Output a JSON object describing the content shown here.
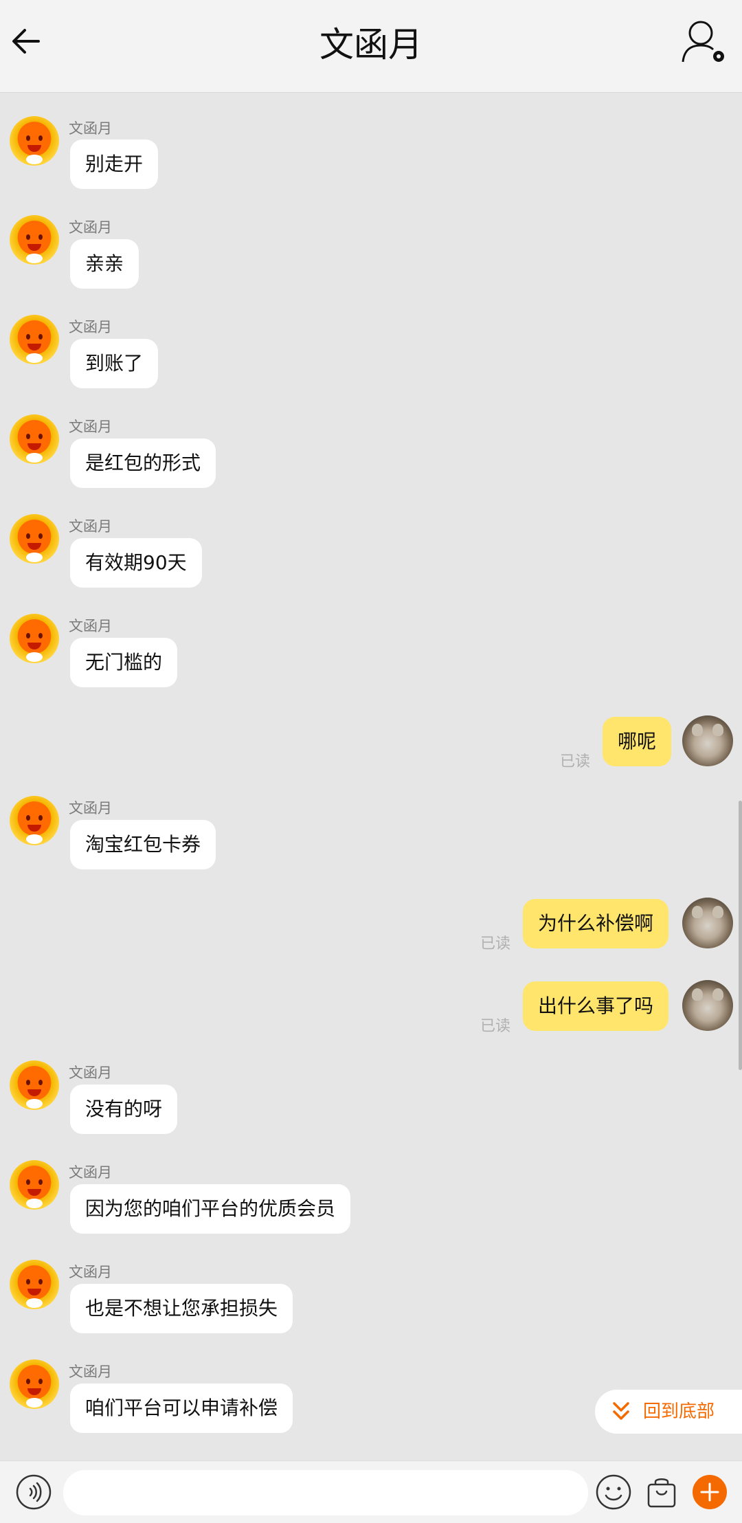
{
  "header": {
    "title": "文函月"
  },
  "messages": [
    {
      "side": "left",
      "sender": "文函月",
      "text": "别走开"
    },
    {
      "side": "left",
      "sender": "文函月",
      "text": "亲亲"
    },
    {
      "side": "left",
      "sender": "文函月",
      "text": "到账了"
    },
    {
      "side": "left",
      "sender": "文函月",
      "text": "是红包的形式"
    },
    {
      "side": "left",
      "sender": "文函月",
      "text": "有效期90天"
    },
    {
      "side": "left",
      "sender": "文函月",
      "text": "无门槛的"
    },
    {
      "side": "right",
      "text": "哪呢",
      "status": "已读"
    },
    {
      "side": "left",
      "sender": "文函月",
      "text": "淘宝红包卡券"
    },
    {
      "side": "right",
      "text": "为什么补偿啊",
      "status": "已读"
    },
    {
      "side": "right",
      "text": "出什么事了吗",
      "status": "已读"
    },
    {
      "side": "left",
      "sender": "文函月",
      "text": "没有的呀"
    },
    {
      "side": "left",
      "sender": "文函月",
      "text": "因为您的咱们平台的优质会员"
    },
    {
      "side": "left",
      "sender": "文函月",
      "text": "也是不想让您承担损失"
    },
    {
      "side": "left",
      "sender": "文函月",
      "text": "咱们平台可以申请补偿"
    }
  ],
  "back_to_bottom": {
    "label": "回到底部"
  },
  "input": {
    "placeholder": ""
  },
  "colors": {
    "accent": "#f56a00",
    "my_bubble": "#ffe56c",
    "bg": "#e6e6e6"
  }
}
